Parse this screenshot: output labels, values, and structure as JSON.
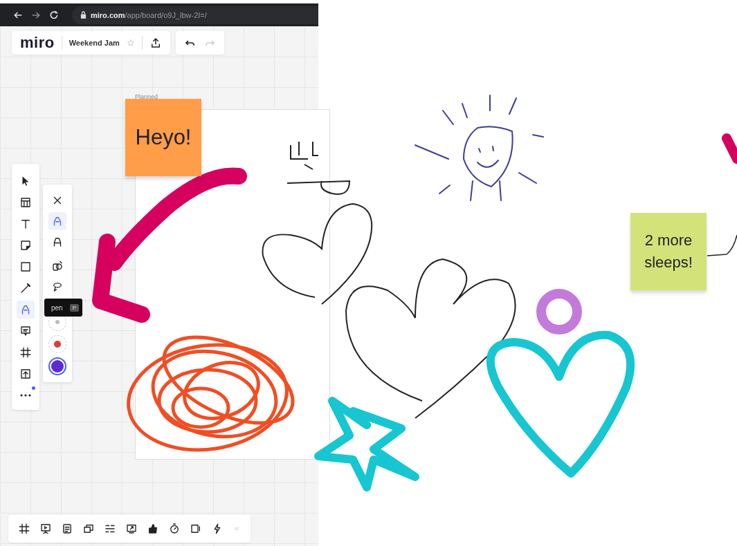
{
  "browser": {
    "url_host": "miro.com",
    "url_path": "/app/board/o9J_lbw-2I=/"
  },
  "topbar": {
    "logo": "miro",
    "board_title": "Weekend Jam",
    "starred": false
  },
  "frame": {
    "label": "Planned"
  },
  "tools": [
    {
      "kind": "select",
      "selected": false
    },
    {
      "kind": "template",
      "selected": false
    },
    {
      "kind": "text",
      "selected": false
    },
    {
      "kind": "sticky",
      "selected": false
    },
    {
      "kind": "shape",
      "selected": false
    },
    {
      "kind": "line",
      "selected": false
    },
    {
      "kind": "pen",
      "selected": true
    },
    {
      "kind": "comment",
      "selected": false
    },
    {
      "kind": "frame",
      "selected": false
    },
    {
      "kind": "upload",
      "selected": false
    },
    {
      "kind": "more",
      "selected": false
    }
  ],
  "pen_panel": {
    "tools": [
      {
        "kind": "close",
        "selected": false
      },
      {
        "kind": "pen",
        "selected": true
      },
      {
        "kind": "highlighter",
        "selected": false
      },
      {
        "kind": "shapes",
        "selected": false
      },
      {
        "kind": "lasso",
        "selected": false
      }
    ],
    "sizes": [
      {
        "selected": false
      },
      {
        "selected": false
      },
      {
        "selected": true
      }
    ]
  },
  "tooltip": {
    "label": "pen",
    "shortcut": "P"
  },
  "sticky_notes": [
    {
      "text": "Heyo!",
      "color": "#ff9d48"
    },
    {
      "text": "2 more sleeps!",
      "color": "#d3e37a"
    }
  ],
  "bottom_tools": [
    {
      "kind": "frame"
    },
    {
      "kind": "present"
    },
    {
      "kind": "notes"
    },
    {
      "kind": "cards"
    },
    {
      "kind": "list"
    },
    {
      "kind": "share-screen"
    },
    {
      "kind": "vote"
    },
    {
      "kind": "timer"
    },
    {
      "kind": "video"
    },
    {
      "kind": "power"
    },
    {
      "kind": "collapse"
    }
  ]
}
